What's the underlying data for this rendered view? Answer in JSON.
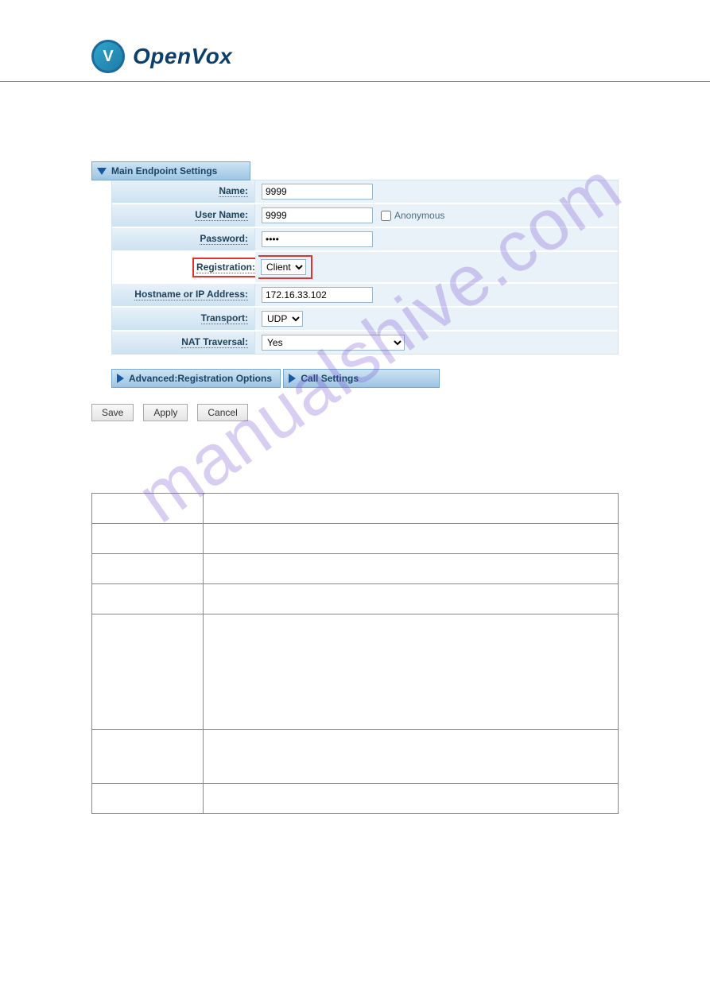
{
  "brand": {
    "name": "OpenVox"
  },
  "watermark": "manualshive.com",
  "panel": {
    "main_header": "Main Endpoint Settings",
    "rows": {
      "name_label": "Name:",
      "name_value": "9999",
      "username_label": "User Name:",
      "username_value": "9999",
      "anonymous_label": "Anonymous",
      "password_label": "Password:",
      "password_value": "••••",
      "registration_label": "Registration:",
      "registration_value": "Client",
      "hostname_label": "Hostname or IP Address:",
      "hostname_value": "172.16.33.102",
      "transport_label": "Transport:",
      "transport_value": "UDP",
      "nat_label": "NAT Traversal:",
      "nat_value": "Yes"
    },
    "advanced_header": "Advanced:Registration Options",
    "call_header": "Call Settings",
    "buttons": {
      "save": "Save",
      "apply": "Apply",
      "cancel": "Cancel"
    }
  }
}
